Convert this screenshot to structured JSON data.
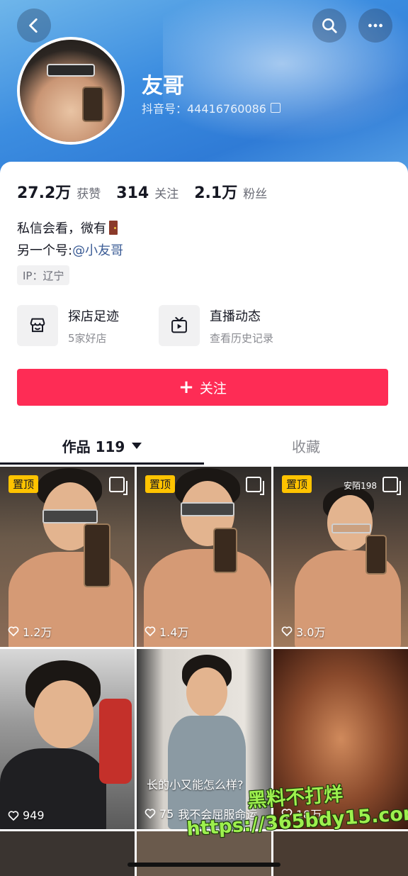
{
  "header": {
    "nickname": "友哥",
    "douyin_id": "抖音号：44416760086",
    "icons": {
      "back": "back-chevron-icon",
      "search": "search-icon",
      "more": "more-dots-icon"
    }
  },
  "stats": [
    {
      "num": "27.2万",
      "label": "获赞"
    },
    {
      "num": "314",
      "label": "关注"
    },
    {
      "num": "2.1万",
      "label": "粉丝"
    }
  ],
  "bio": {
    "line1": "私信会看，微有",
    "line2_prefix": "另一个号:",
    "line2_mention": "@小友哥",
    "ip": "IP：辽宁"
  },
  "features": [
    {
      "title": "探店足迹",
      "subtitle": "5家好店",
      "icon": "store-icon"
    },
    {
      "title": "直播动态",
      "subtitle": "查看历史记录",
      "icon": "tv-play-icon"
    }
  ],
  "follow_button": {
    "label": "关注"
  },
  "tabs": {
    "works": "作品 119",
    "favorites": "收藏"
  },
  "grid": [
    {
      "pinned": "置顶",
      "likes": "1.2万",
      "multi": true
    },
    {
      "pinned": "置顶",
      "likes": "1.4万",
      "multi": true
    },
    {
      "pinned": "置顶",
      "likes": "3.0万",
      "multi": true,
      "corner_text": "安陌198"
    },
    {
      "likes": "949"
    },
    {
      "likes": "75",
      "title": "长的小又能怎么样?",
      "caption": "我不会屈服命运"
    },
    {
      "likes": "18万"
    }
  ],
  "watermark": {
    "line1": "黑料不打烊",
    "line2": "https://365bdy15.com"
  },
  "colors": {
    "accent": "#fe2c55",
    "pin": "#ffc300",
    "mention": "#3a5b95"
  }
}
